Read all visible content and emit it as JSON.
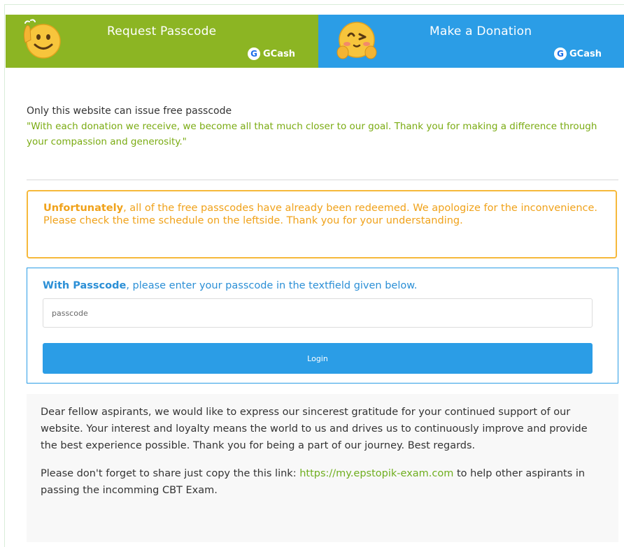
{
  "banners": {
    "request": {
      "title": "Request Passcode",
      "gcash": "GCash",
      "gcash_logo": "G",
      "emoji": "waving-smile-emoji",
      "color": "#8cb523"
    },
    "donate": {
      "title": "Make a Donation",
      "gcash": "GCash",
      "gcash_logo": "G",
      "emoji": "winking-kiss-emoji",
      "color": "#2b9de6"
    }
  },
  "intro": {
    "line1": "Only this website can issue free passcode",
    "quote": "\"With each donation we receive, we become all that much closer to our goal. Thank you for making a difference through your compassion and generosity.\""
  },
  "notice": {
    "bold": "Unfortunately",
    "line1": ", all of the free passcodes have already been redeemed. We apologize for the inconvenience.",
    "line2": "Please check the time schedule on the leftside. Thank you for your understanding."
  },
  "login": {
    "bold": "With Passcode",
    "message": ", please enter your passcode in the textfield given below.",
    "placeholder": "passcode",
    "value": "",
    "button": "Login"
  },
  "thanks": {
    "paragraph1": "Dear fellow aspirants, we would like to express our sincerest gratitude for your continued support of our website. Your interest and loyalty means the world to us and drives us to continuously improve and provide the best experience possible. Thank you for being a part of our journey. Best regards.",
    "share_prefix": "Please don't forget to share just copy the this link: ",
    "share_link": "https://my.epstopik-exam.com",
    "share_suffix": " to help other aspirants in passing the incomming CBT Exam."
  }
}
